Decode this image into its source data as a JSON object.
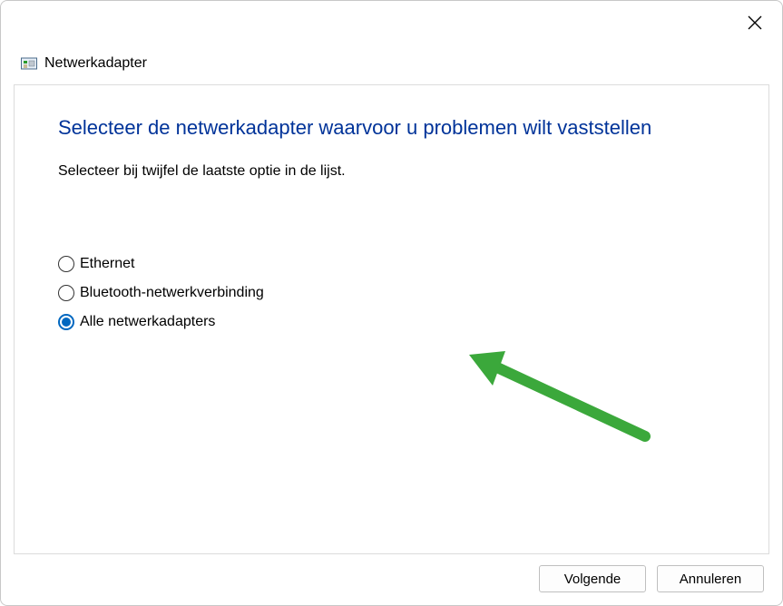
{
  "window": {
    "title": "Netwerkadapter"
  },
  "content": {
    "heading": "Selecteer de netwerkadapter waarvoor u problemen wilt vaststellen",
    "subtext": "Selecteer bij twijfel de laatste optie in de lijst."
  },
  "options": [
    {
      "label": "Ethernet",
      "selected": false
    },
    {
      "label": "Bluetooth-netwerkverbinding",
      "selected": false
    },
    {
      "label": "Alle netwerkadapters",
      "selected": true
    }
  ],
  "footer": {
    "next": "Volgende",
    "cancel": "Annuleren"
  },
  "colors": {
    "accent": "#0067c0",
    "heading": "#003399",
    "arrow": "#3ba83b"
  }
}
